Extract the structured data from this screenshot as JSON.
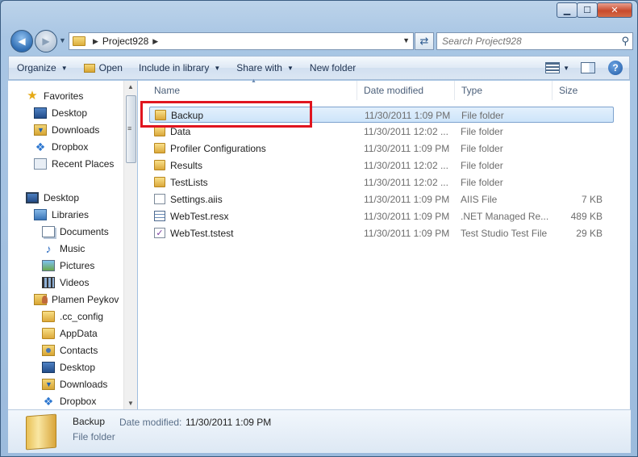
{
  "window": {
    "caption_buttons": {
      "minimize": "▁",
      "maximize": "☐",
      "close": "✕"
    }
  },
  "navigation": {
    "back": "◀",
    "forward": "▶",
    "breadcrumb": [
      "Project928"
    ],
    "search_placeholder": "Search Project928"
  },
  "toolbar": {
    "organize": "Organize",
    "open": "Open",
    "include_in_library": "Include in library",
    "share_with": "Share with",
    "new_folder": "New folder",
    "help": "?"
  },
  "sidebar": {
    "favorites": {
      "label": "Favorites",
      "items": [
        {
          "label": "Desktop",
          "icon": "desktop-icon"
        },
        {
          "label": "Downloads",
          "icon": "downloads-icon"
        },
        {
          "label": "Dropbox",
          "icon": "dropbox-icon"
        },
        {
          "label": "Recent Places",
          "icon": "recent-places-icon"
        }
      ]
    },
    "desktop": {
      "label": "Desktop",
      "items": [
        {
          "label": "Libraries",
          "icon": "libraries-icon"
        },
        {
          "label": "Documents",
          "icon": "documents-icon"
        },
        {
          "label": "Music",
          "icon": "music-icon"
        },
        {
          "label": "Pictures",
          "icon": "pictures-icon"
        },
        {
          "label": "Videos",
          "icon": "videos-icon"
        },
        {
          "label": "Plamen Peykov",
          "icon": "user-folder-icon"
        },
        {
          "label": ".cc_config",
          "icon": "folder-icon"
        },
        {
          "label": "AppData",
          "icon": "folder-icon"
        },
        {
          "label": "Contacts",
          "icon": "contacts-icon"
        },
        {
          "label": "Desktop",
          "icon": "desktop-folder-icon"
        },
        {
          "label": "Downloads",
          "icon": "downloads-icon"
        },
        {
          "label": "Dropbox",
          "icon": "dropbox-icon"
        }
      ]
    }
  },
  "file_list": {
    "columns": [
      "Name",
      "Date modified",
      "Type",
      "Size"
    ],
    "rows": [
      {
        "name": "Backup",
        "date": "11/30/2011 1:09 PM",
        "type": "File folder",
        "size": "",
        "icon": "folder-icon",
        "selected": true
      },
      {
        "name": "Data",
        "date": "11/30/2011 12:02 ...",
        "type": "File folder",
        "size": "",
        "icon": "folder-icon"
      },
      {
        "name": "Profiler Configurations",
        "date": "11/30/2011 1:09 PM",
        "type": "File folder",
        "size": "",
        "icon": "folder-icon"
      },
      {
        "name": "Results",
        "date": "11/30/2011 12:02 ...",
        "type": "File folder",
        "size": "",
        "icon": "folder-icon"
      },
      {
        "name": "TestLists",
        "date": "11/30/2011 12:02 ...",
        "type": "File folder",
        "size": "",
        "icon": "folder-icon"
      },
      {
        "name": "Settings.aiis",
        "date": "11/30/2011 1:09 PM",
        "type": "AIIS File",
        "size": "7 KB",
        "icon": "document-icon"
      },
      {
        "name": "WebTest.resx",
        "date": "11/30/2011 1:09 PM",
        "type": ".NET Managed Re...",
        "size": "489 KB",
        "icon": "resx-icon"
      },
      {
        "name": "WebTest.tstest",
        "date": "11/30/2011 1:09 PM",
        "type": "Test Studio Test File",
        "size": "29 KB",
        "icon": "tstest-icon"
      }
    ]
  },
  "details_pane": {
    "name": "Backup",
    "date_label": "Date modified:",
    "date_value": "11/30/2011 1:09 PM",
    "type": "File folder"
  },
  "colors": {
    "highlight_border": "#e0151f",
    "selection": "#cde4fa"
  }
}
